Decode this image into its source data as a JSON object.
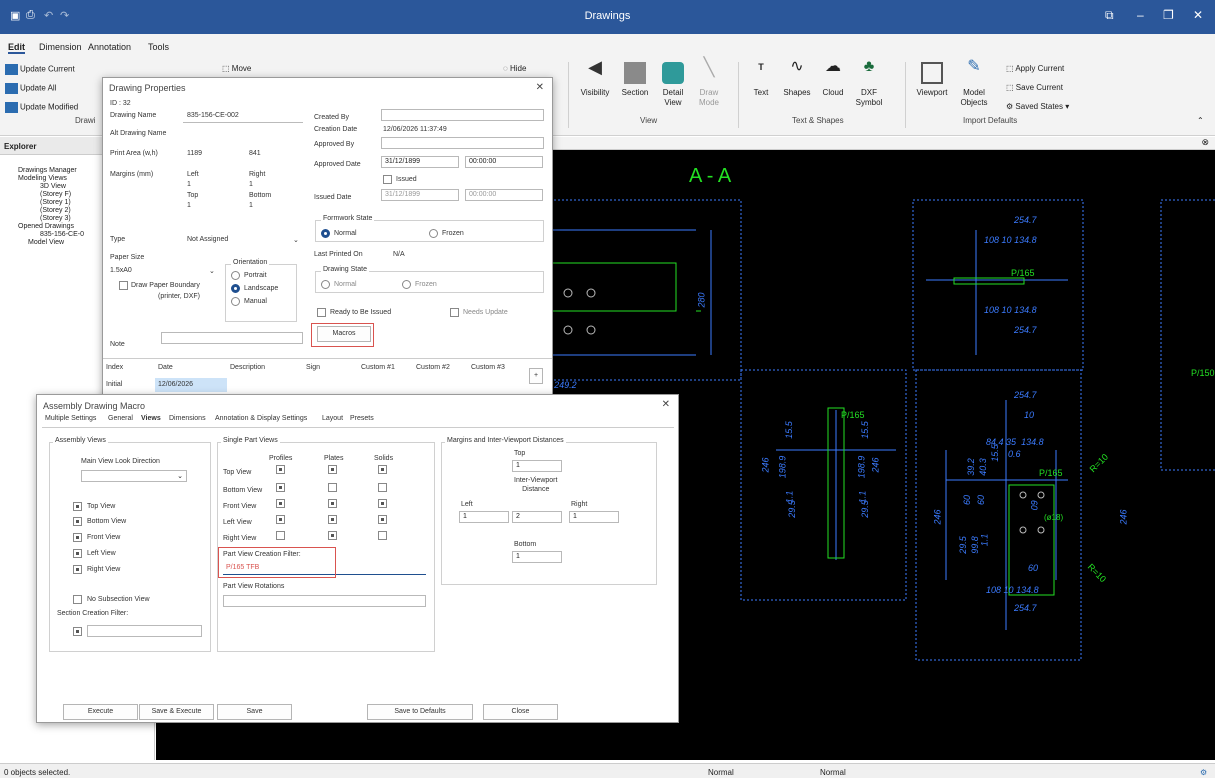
{
  "app": {
    "title": "Drawings",
    "quick_access": [
      "save-icon",
      "print-icon",
      "undo-icon",
      "redo-icon"
    ],
    "window_controls": [
      "restore-icon",
      "minimize-icon",
      "maximize-icon",
      "close-icon"
    ]
  },
  "ribbon": {
    "tabs": [
      "Edit",
      "Dimension",
      "Annotation",
      "Tools"
    ],
    "update": {
      "current": "Update Current",
      "all": "Update All",
      "modified": "Update Modified",
      "group": "Drawi"
    },
    "move": "Move",
    "hide": "Hide",
    "view_group": {
      "buttons": [
        "Visibility",
        "Section",
        "Detail\nView",
        "Draw\nMode"
      ],
      "name": "View"
    },
    "text_group": {
      "buttons": [
        "Text",
        "Shapes",
        "Cloud",
        "DXF\nSymbol"
      ],
      "name": "Text & Shapes"
    },
    "import_group": {
      "viewport": "Viewport",
      "model_objects": "Model\nObjects",
      "apply_current": "Apply Current",
      "save_current": "Save Current",
      "saved_states": "Saved States",
      "name": "Import Defaults"
    }
  },
  "explorer": {
    "title": "Explorer",
    "items": [
      "Drawings Manager",
      "Modeling Views",
      "3D View",
      "(Storey F)",
      "(Storey 1)",
      "(Storey 2)",
      "(Storey 3)",
      "Opened Drawings",
      "835-156-CE-0",
      "Model View"
    ]
  },
  "drawing_properties": {
    "title": "Drawing Properties",
    "id": "ID : 32",
    "drawing_name_label": "Drawing Name",
    "drawing_name": "835-156-CE-002",
    "alt_name_label": "Alt Drawing Name",
    "print_area_label": "Print Area (w,h)",
    "print_w": "1189",
    "print_h": "841",
    "margins_label": "Margins (mm)",
    "left_label": "Left",
    "right_label": "Right",
    "top_label": "Top",
    "bottom_label": "Bottom",
    "left": "1",
    "right": "1",
    "top": "1",
    "bottom": "1",
    "type_label": "Type",
    "type_value": "Not Assigned",
    "paper_size_label": "Paper Size",
    "paper_size": "1.5xA0",
    "draw_boundary": "Draw Paper Boundary",
    "draw_boundary_sub": "(printer, DXF)",
    "orientation_label": "Orientation",
    "portrait": "Portrait",
    "landscape": "Landscape",
    "manual": "Manual",
    "note_label": "Note",
    "created_by_label": "Created By",
    "creation_date_label": "Creation Date",
    "creation_date": "12/06/2026 11:37:49",
    "approved_by_label": "Approved By",
    "approved_date_label": "Approved Date",
    "approved_date": "31/12/1899",
    "approved_time": "00:00:00",
    "issued_label": "Issued",
    "issued_date_label": "Issued Date",
    "issued_date": "31/12/1899",
    "issued_time": "00:00:00",
    "formwork_state_label": "Formwork State",
    "normal": "Normal",
    "frozen": "Frozen",
    "last_printed_label": "Last Printed On",
    "last_printed": "N/A",
    "drawing_state_label": "Drawing State",
    "ready_issued": "Ready to Be Issued",
    "needs_update": "Needs Update",
    "macros_button": "Macros",
    "table_headers": [
      "Index",
      "Date",
      "Description",
      "Sign",
      "Custom #1",
      "Custom #2",
      "Custom #3"
    ],
    "table_row": [
      "Initial",
      "12/06/2026"
    ]
  },
  "macro_dialog": {
    "title": "Assembly Drawing Macro",
    "tabs": [
      "Multiple Settings",
      "General",
      "Views",
      "Dimensions",
      "Annotation & Display Settings",
      "Layout",
      "Presets"
    ],
    "assembly_views_label": "Assembly Views",
    "main_view_look": "Main View Look Direction",
    "assembly_list": [
      "Top View",
      "Bottom View",
      "Front View",
      "Left View",
      "Right View"
    ],
    "no_subsection": "No Subsection View",
    "section_filter_label": "Section Creation Filter:",
    "single_part_label": "Single Part Views",
    "col_headers": [
      "Profiles",
      "Plates",
      "Solids"
    ],
    "part_rows": [
      "Top View",
      "Bottom View",
      "Front View",
      "Left View",
      "Right View"
    ],
    "part_filter_label": "Part View Creation Filter:",
    "part_filter_value": "P/165 TFB",
    "part_rotations_label": "Part View Rotations",
    "margins_label": "Margins and Inter-Viewport Distances",
    "m_top_label": "Top",
    "m_top": "1",
    "inter_label": "Inter-Viewport\nDistance",
    "m_left_label": "Left",
    "m_left": "1",
    "m_inter": "2",
    "m_right_label": "Right",
    "m_right": "1",
    "m_bottom_label": "Bottom",
    "m_bottom": "1",
    "buttons": [
      "Execute",
      "Save & Execute",
      "Save",
      "Save to Defaults",
      "Close"
    ]
  },
  "cad": {
    "section_title": "A - A",
    "labels": [
      "254.7",
      "108",
      "10",
      "134.8",
      "P/165",
      "108",
      "10",
      "134.8",
      "254.7",
      "280",
      "72",
      "72",
      "249.2",
      "P/150",
      "254.7",
      "10",
      "84.4",
      "35",
      "134.8",
      "0.6",
      "P/165",
      "R=10",
      "246",
      "198.9",
      "15.5",
      "1.1",
      "29.5",
      "246",
      "198.9",
      "15.5",
      "1.1",
      "29.5",
      "P/165",
      "39.2",
      "40.3",
      "15.5",
      "60",
      "60",
      "60",
      "29.5",
      "99.8",
      "1.1",
      "(ø18)",
      "246",
      "246",
      "R=10",
      "60",
      "108",
      "10",
      "134.8",
      "254.7"
    ]
  },
  "status": {
    "selection": "0 objects selected.",
    "mode1": "Normal",
    "mode2": "Normal"
  },
  "colors": {
    "title_bar": "#2b579a",
    "cad_bg": "#000000",
    "cad_green": "#23e023",
    "cad_dim": "#3b7bff",
    "highlight": "#d9534f"
  }
}
